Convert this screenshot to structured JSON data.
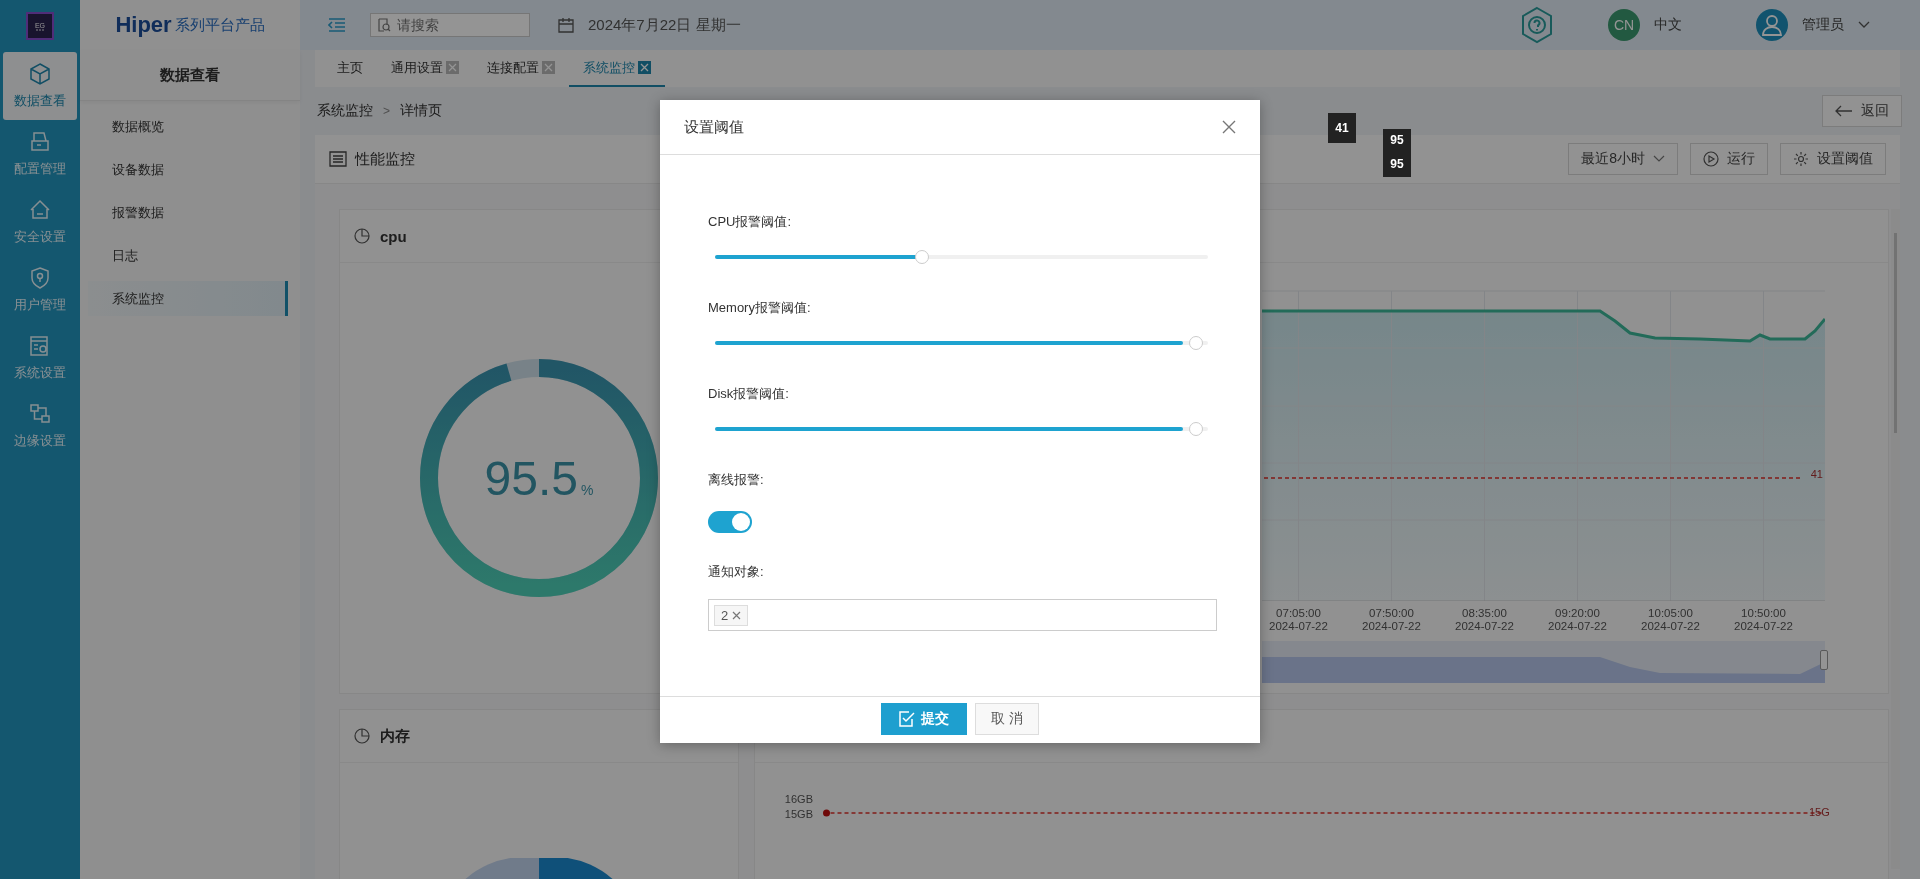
{
  "rail": {
    "logo_text": "EG",
    "items": [
      {
        "label": "数据查看",
        "selected": true
      },
      {
        "label": "配置管理",
        "selected": false
      },
      {
        "label": "安全设置",
        "selected": false
      },
      {
        "label": "用户管理",
        "selected": false
      },
      {
        "label": "系统设置",
        "selected": false
      },
      {
        "label": "边缘设置",
        "selected": false
      }
    ]
  },
  "brand": {
    "name": "Hiper",
    "tagline": "系列平台产品"
  },
  "sidebar": {
    "title": "数据查看",
    "items": [
      {
        "label": "数据概览",
        "selected": false
      },
      {
        "label": "设备数据",
        "selected": false
      },
      {
        "label": "报警数据",
        "selected": false
      },
      {
        "label": "日志",
        "selected": false
      },
      {
        "label": "系统监控",
        "selected": true
      }
    ]
  },
  "topbar": {
    "search": {
      "placeholder": "请搜索"
    },
    "date": "2024年7月22日 星期一",
    "language": {
      "code": "CN",
      "label": "中文"
    },
    "user": {
      "name": "管理员"
    }
  },
  "tabs": [
    {
      "label": "主页",
      "closable": false,
      "selected": false
    },
    {
      "label": "通用设置",
      "closable": true,
      "selected": false
    },
    {
      "label": "连接配置",
      "closable": true,
      "selected": false
    },
    {
      "label": "系统监控",
      "closable": true,
      "selected": true
    }
  ],
  "breadcrumb": {
    "items": [
      "系统监控",
      "详情页"
    ],
    "separator": ">"
  },
  "back_button": "返回",
  "panel": {
    "title": "性能监控",
    "range": "最近8小时",
    "run_button": "运行",
    "threshold_button": "设置阈值"
  },
  "cpu_card": {
    "title": "cpu",
    "value": "95.5",
    "unit": "%",
    "level": 0.955
  },
  "cpu_chart": {
    "x_labels": [
      {
        "time": "07:05:00",
        "date": "2024-07-22"
      },
      {
        "time": "07:50:00",
        "date": "2024-07-22"
      },
      {
        "time": "08:35:00",
        "date": "2024-07-22"
      },
      {
        "time": "09:20:00",
        "date": "2024-07-22"
      },
      {
        "time": "10:05:00",
        "date": "2024-07-22"
      },
      {
        "time": "10:50:00",
        "date": "2024-07-22"
      }
    ],
    "threshold_label": "41"
  },
  "tooltips": [
    "41",
    "95",
    "95"
  ],
  "memory_card": {
    "title": "内存"
  },
  "memory_chart": {
    "y_labels": [
      "16GB",
      "15GB"
    ],
    "threshold_label": "15G"
  },
  "modal": {
    "title": "设置阈值",
    "sliders": [
      {
        "label": "CPU报警阈值:",
        "level": 0.41
      },
      {
        "label": "Memory报警阈值:",
        "level": 0.95
      },
      {
        "label": "Disk报警阈值:",
        "level": 0.95
      }
    ],
    "offline_alarm": {
      "label": "离线报警:",
      "on": true
    },
    "notify": {
      "label": "通知对象:",
      "tags": [
        "2"
      ]
    },
    "submit": "提交",
    "cancel": "取 消"
  }
}
